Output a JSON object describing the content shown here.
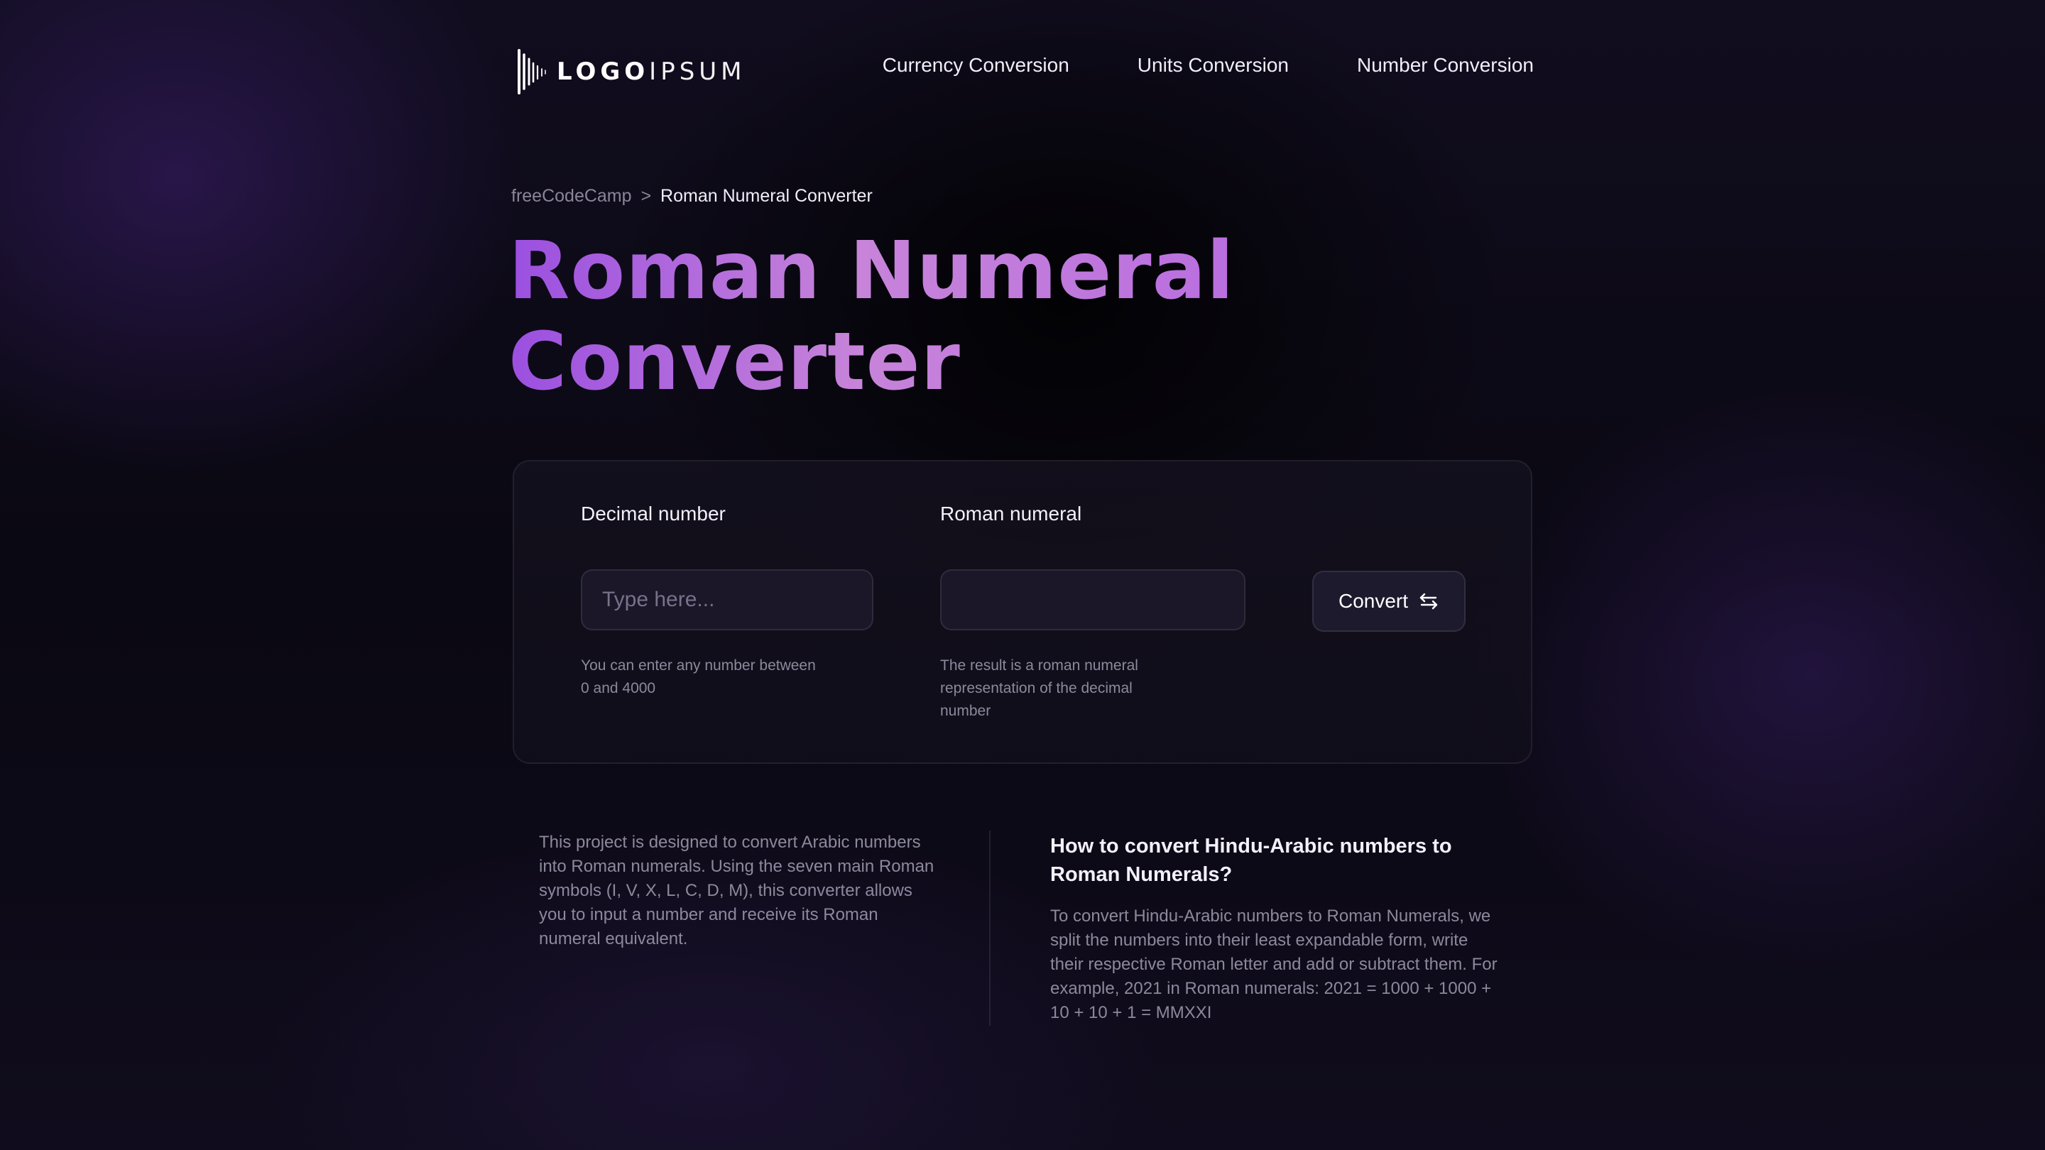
{
  "header": {
    "logo": {
      "bold_text": "LOGO",
      "light_text": "IPSUM"
    },
    "nav": [
      {
        "label": "Currency Conversion"
      },
      {
        "label": "Units Conversion"
      },
      {
        "label": "Number Conversion"
      }
    ]
  },
  "breadcrumb": {
    "parent": "freeCodeCamp",
    "separator": ">",
    "current": "Roman Numeral Converter"
  },
  "page": {
    "title_line1": "Roman Numeral",
    "title_line2": "Converter"
  },
  "converter": {
    "decimal_label": "Decimal number",
    "decimal_placeholder": "Type here...",
    "decimal_value": "",
    "decimal_hint_line1": "You can enter any number between",
    "decimal_hint_line2": "0 and 4000",
    "roman_label": "Roman numeral",
    "roman_value": "",
    "roman_hint_line1": "The result is a roman numeral",
    "roman_hint_line2": "representation of the decimal",
    "roman_hint_line3": "number",
    "convert_label": "Convert",
    "convert_icon": "swap-arrows-icon"
  },
  "info": {
    "description": "This project is designed to convert Arabic numbers into Roman numerals. Using the seven main Roman symbols (I, V, X, L, C, D, M), this converter allows you to input a number and receive its Roman numeral equivalent.",
    "heading": "How to convert Hindu-Arabic numbers to Roman Numerals?",
    "body": "To convert Hindu-Arabic numbers to Roman Numerals, we split the numbers into their least expandable form, write their respective Roman letter and add or subtract them. For example, 2021 in Roman numerals: 2021 = 1000 + 1000 + 10 + 10 + 1 = MMXXI"
  },
  "colors": {
    "accent_gradient_start": "#9b4fe0",
    "accent_gradient_mid": "#c784d9",
    "background": "#0b0812",
    "muted_text": "#8d889c"
  }
}
